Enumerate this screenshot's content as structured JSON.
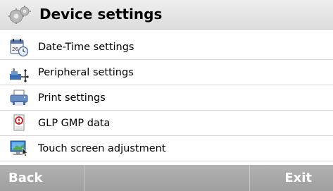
{
  "header": {
    "title": "Device settings",
    "icon": "gears-icon"
  },
  "menu": {
    "items": [
      {
        "label": "Date-Time settings",
        "icon": "calendar-clock-icon"
      },
      {
        "label": "Peripheral settings",
        "icon": "peripheral-devices-icon"
      },
      {
        "label": "Print settings",
        "icon": "printer-icon"
      },
      {
        "label": "GLP GMP data",
        "icon": "info-document-icon"
      },
      {
        "label": "Touch screen adjustment",
        "icon": "monitor-touch-icon"
      }
    ]
  },
  "footer": {
    "back_label": "Back",
    "middle_label": "",
    "exit_label": "Exit"
  },
  "colors": {
    "title_bar": "#e4e4e4",
    "footer_bar": "#a9a9a9",
    "footer_text": "#ffffff",
    "divider": "#d6d6d6"
  }
}
